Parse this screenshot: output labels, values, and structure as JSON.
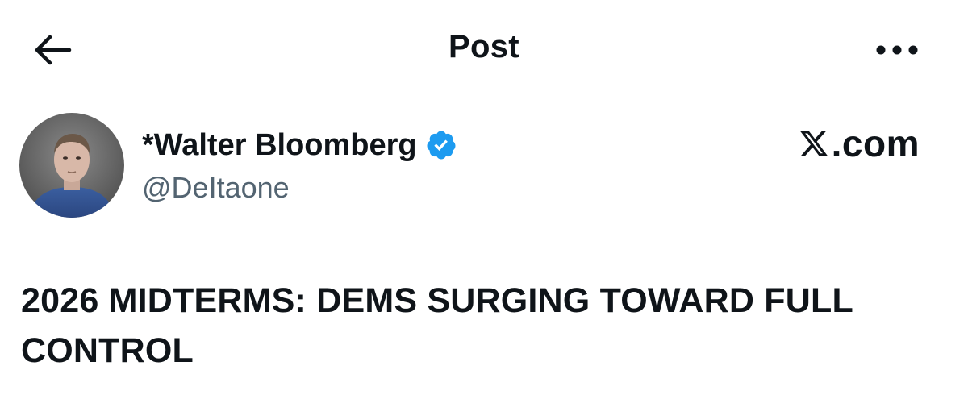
{
  "header": {
    "title": "Post",
    "back_icon": "arrow-left-icon",
    "more_icon": "more-horizontal-icon"
  },
  "author": {
    "display_name": "*Walter Bloomberg",
    "handle": "@DeItaone",
    "verified": true,
    "verified_color": "#1d9bf0",
    "avatar_icon": "profile-photo"
  },
  "watermark": {
    "text": ".com",
    "logo_icon": "x-logo-icon"
  },
  "post": {
    "text": "2026 MIDTERMS: DEMS SURGING TOWARD FULL CONTROL"
  },
  "colors": {
    "text_primary": "#0f1419",
    "text_secondary": "#536471",
    "accent": "#1d9bf0",
    "background": "#ffffff"
  }
}
